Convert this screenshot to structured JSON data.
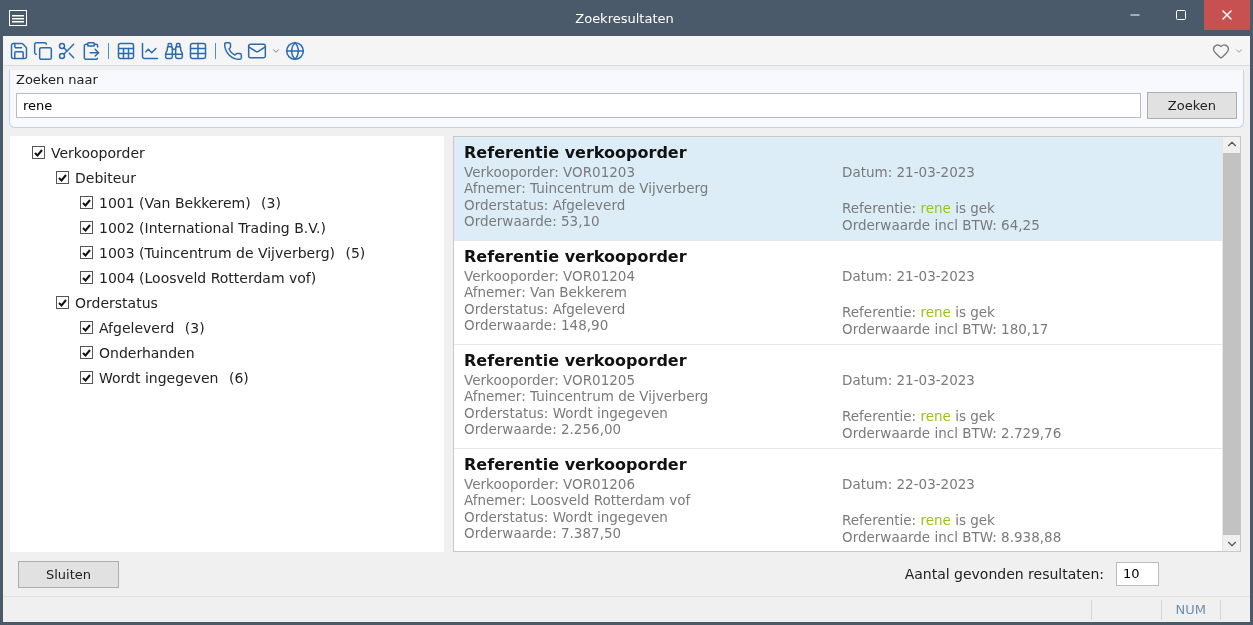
{
  "window": {
    "title": "Zoekresultaten"
  },
  "search": {
    "label": "Zoeken naar",
    "value": "rene",
    "button": "Zoeken"
  },
  "filter_tree": [
    {
      "label": "Verkooporder",
      "checked": true,
      "children": [
        {
          "label": "Debiteur",
          "checked": true,
          "children": [
            {
              "label": "1001 (Van Bekkerem)",
              "count": "(3)",
              "checked": true
            },
            {
              "label": "1002 (International Trading B.V.)",
              "checked": true
            },
            {
              "label": "1003 (Tuincentrum de Vijverberg)",
              "count": "(5)",
              "checked": true
            },
            {
              "label": "1004 (Loosveld Rotterdam vof)",
              "checked": true
            }
          ]
        },
        {
          "label": "Orderstatus",
          "checked": true,
          "children": [
            {
              "label": "Afgeleverd",
              "count": "(3)",
              "checked": true
            },
            {
              "label": "Onderhanden",
              "checked": true
            },
            {
              "label": "Wordt ingegeven",
              "count": "(6)",
              "checked": true
            }
          ]
        }
      ]
    }
  ],
  "results": [
    {
      "title": "Referentie verkooporder",
      "lines": [
        "Verkooporder: VOR01203",
        "Afnemer: Tuincentrum de Vijverberg",
        "Orderstatus: Afgeleverd",
        "Orderwaarde: 53,10"
      ],
      "date": "Datum: 21-03-2023",
      "reference_label": "Referentie:",
      "reference_match": "rene",
      "reference_rest": "is gek",
      "total": "Orderwaarde incl BTW: 64,25",
      "selected": true
    },
    {
      "title": "Referentie verkooporder",
      "lines": [
        "Verkooporder: VOR01204",
        "Afnemer: Van Bekkerem",
        "Orderstatus: Afgeleverd",
        "Orderwaarde: 148,90"
      ],
      "date": "Datum: 21-03-2023",
      "reference_label": "Referentie:",
      "reference_match": "rene",
      "reference_rest": "is gek",
      "total": "Orderwaarde incl BTW: 180,17",
      "selected": false
    },
    {
      "title": "Referentie verkooporder",
      "lines": [
        "Verkooporder: VOR01205",
        "Afnemer: Tuincentrum de Vijverberg",
        "Orderstatus: Wordt ingegeven",
        "Orderwaarde: 2.256,00"
      ],
      "date": "Datum: 21-03-2023",
      "reference_label": "Referentie:",
      "reference_match": "rene",
      "reference_rest": "is gek",
      "total": "Orderwaarde incl BTW: 2.729,76",
      "selected": false
    },
    {
      "title": "Referentie verkooporder",
      "lines": [
        "Verkooporder: VOR01206",
        "Afnemer: Loosveld Rotterdam vof",
        "Orderstatus: Wordt ingegeven",
        "Orderwaarde: 7.387,50"
      ],
      "date": "Datum: 22-03-2023",
      "reference_label": "Referentie:",
      "reference_match": "rene",
      "reference_rest": "is gek",
      "total": "Orderwaarde incl BTW: 8.938,88",
      "selected": false
    }
  ],
  "close_button": "Sluiten",
  "result_count": {
    "label": "Aantal gevonden resultaten:",
    "value": "10"
  },
  "status_bar": {
    "indicator": "NUM"
  }
}
